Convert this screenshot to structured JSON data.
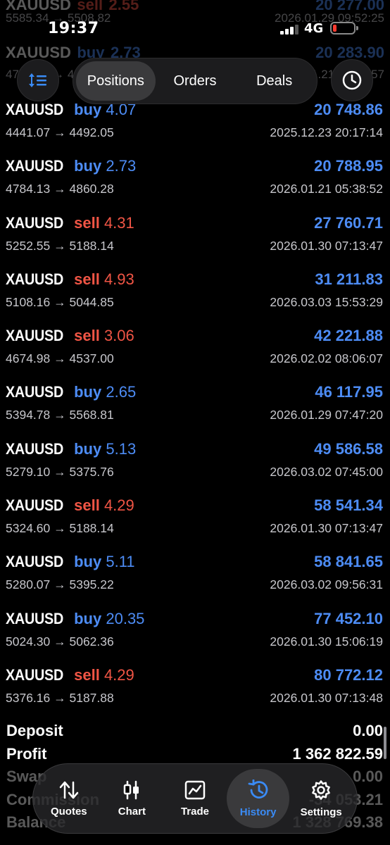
{
  "status_bar": {
    "time": "19:37",
    "network": "4G"
  },
  "ghost_rows": [
    {
      "symbol": "XAUUSD",
      "type": "sell",
      "volume": "2.55",
      "prices": "5585.34 → 5508.82",
      "profit": "20 277.00",
      "time": "2026.01.29 09:52:25"
    },
    {
      "symbol": "XAUUSD",
      "type": "buy",
      "volume": "2.73",
      "prices": "4784.13 → 4860.28",
      "profit": "20 283.90",
      "time": "2026.01.21 05:38:57"
    }
  ],
  "header": {
    "tabs": [
      {
        "label": "Positions",
        "active": true
      },
      {
        "label": "Orders",
        "active": false
      },
      {
        "label": "Deals",
        "active": false
      }
    ],
    "left_icon": "sort-icon",
    "right_icon": "clock-icon"
  },
  "rows": [
    {
      "symbol": "XAUUSD",
      "type": "buy",
      "volume": "4.07",
      "prices": "4441.07 → 4492.05",
      "profit": "20 748.86",
      "time": "2025.12.23 20:17:14"
    },
    {
      "symbol": "XAUUSD",
      "type": "buy",
      "volume": "2.73",
      "prices": "4784.13 → 4860.28",
      "profit": "20 788.95",
      "time": "2026.01.21 05:38:52"
    },
    {
      "symbol": "XAUUSD",
      "type": "sell",
      "volume": "4.31",
      "prices": "5252.55 → 5188.14",
      "profit": "27 760.71",
      "time": "2026.01.30 07:13:47"
    },
    {
      "symbol": "XAUUSD",
      "type": "sell",
      "volume": "4.93",
      "prices": "5108.16 → 5044.85",
      "profit": "31 211.83",
      "time": "2026.03.03 15:53:29"
    },
    {
      "symbol": "XAUUSD",
      "type": "sell",
      "volume": "3.06",
      "prices": "4674.98 → 4537.00",
      "profit": "42 221.88",
      "time": "2026.02.02 08:06:07"
    },
    {
      "symbol": "XAUUSD",
      "type": "buy",
      "volume": "2.65",
      "prices": "5394.78 → 5568.81",
      "profit": "46 117.95",
      "time": "2026.01.29 07:47:20"
    },
    {
      "symbol": "XAUUSD",
      "type": "buy",
      "volume": "5.13",
      "prices": "5279.10 → 5375.76",
      "profit": "49 586.58",
      "time": "2026.03.02 07:45:00"
    },
    {
      "symbol": "XAUUSD",
      "type": "sell",
      "volume": "4.29",
      "prices": "5324.60 → 5188.14",
      "profit": "58 541.34",
      "time": "2026.01.30 07:13:47"
    },
    {
      "symbol": "XAUUSD",
      "type": "buy",
      "volume": "5.11",
      "prices": "5280.07 → 5395.22",
      "profit": "58 841.65",
      "time": "2026.03.02 09:56:31"
    },
    {
      "symbol": "XAUUSD",
      "type": "buy",
      "volume": "20.35",
      "prices": "5024.30 → 5062.36",
      "profit": "77 452.10",
      "time": "2026.01.30 15:06:19"
    },
    {
      "symbol": "XAUUSD",
      "type": "sell",
      "volume": "4.29",
      "prices": "5376.16 → 5187.88",
      "profit": "80 772.12",
      "time": "2026.01.30 07:13:48"
    }
  ],
  "summary": [
    {
      "label": "Deposit",
      "value": "0.00",
      "dim": false
    },
    {
      "label": "Profit",
      "value": "1 362 822.59",
      "dim": false
    },
    {
      "label": "Swap",
      "value": "0.00",
      "dim": true
    },
    {
      "label": "Commission",
      "value": "-34 053.21",
      "dim": true
    },
    {
      "label": "Balance",
      "value": "1 328 769.38",
      "dim": true
    }
  ],
  "tabbar": [
    {
      "label": "Quotes",
      "icon": "quotes-icon",
      "active": false
    },
    {
      "label": "Chart",
      "icon": "candlestick-icon",
      "active": false
    },
    {
      "label": "Trade",
      "icon": "trade-chart-icon",
      "active": false
    },
    {
      "label": "History",
      "icon": "history-icon",
      "active": true
    },
    {
      "label": "Settings",
      "icon": "gear-icon",
      "active": false
    }
  ],
  "colors": {
    "buy": "#4d8cf5",
    "sell": "#f05545",
    "accent": "#3a8bf5",
    "battery": "#ff3b30"
  }
}
